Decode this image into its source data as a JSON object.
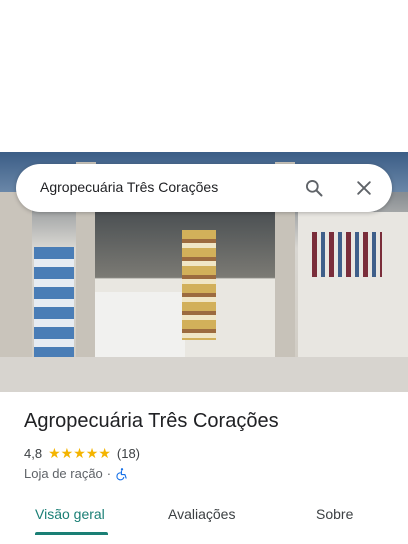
{
  "search": {
    "query": "Agropecuária Três Corações"
  },
  "icons": {
    "search": "search-icon",
    "close": "close-icon",
    "accessibility": "wheelchair-accessible-icon"
  },
  "place": {
    "name": "Agropecuária Três Corações",
    "rating": "4,8",
    "stars": 5,
    "review_count": "(18)",
    "category": "Loja de ração",
    "separator": "·"
  },
  "tabs": [
    {
      "label": "Visão geral",
      "active": true
    },
    {
      "label": "Avaliações",
      "active": false
    },
    {
      "label": "Sobre",
      "active": false
    }
  ],
  "colors": {
    "accent": "#1a7f75",
    "star": "#f4b400",
    "accessibility": "#1a73e8"
  }
}
